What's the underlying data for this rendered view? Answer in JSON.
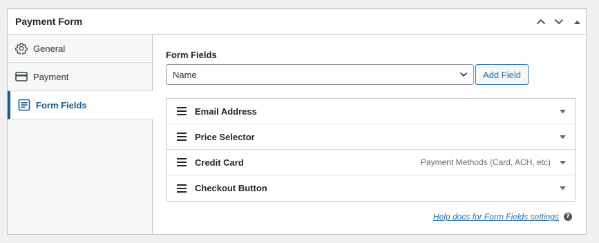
{
  "panel": {
    "title": "Payment Form",
    "controls": [
      "chevron-up-icon",
      "chevron-down-icon",
      "triangle-up-icon"
    ]
  },
  "sidebar": {
    "items": [
      {
        "label": "General",
        "icon": "gear-icon",
        "active": false
      },
      {
        "label": "Payment",
        "icon": "credit-card-icon",
        "active": false
      },
      {
        "label": "Form Fields",
        "icon": "form-icon",
        "active": true
      }
    ]
  },
  "form_fields": {
    "label": "Form Fields",
    "select_value": "Name",
    "add_button_label": "Add Field",
    "fields": [
      {
        "name": "Email Address",
        "note": ""
      },
      {
        "name": "Price Selector",
        "note": ""
      },
      {
        "name": "Credit Card",
        "note": "Payment Methods (Card, ACH, etc)"
      },
      {
        "name": "Checkout Button",
        "note": ""
      }
    ],
    "help_link": "Help docs for Form Fields settings",
    "help_icon": "?"
  },
  "colors": {
    "accent": "#2271b1",
    "active": "#135e96",
    "border": "#c3c4c7",
    "background": "#f0f0f1"
  }
}
